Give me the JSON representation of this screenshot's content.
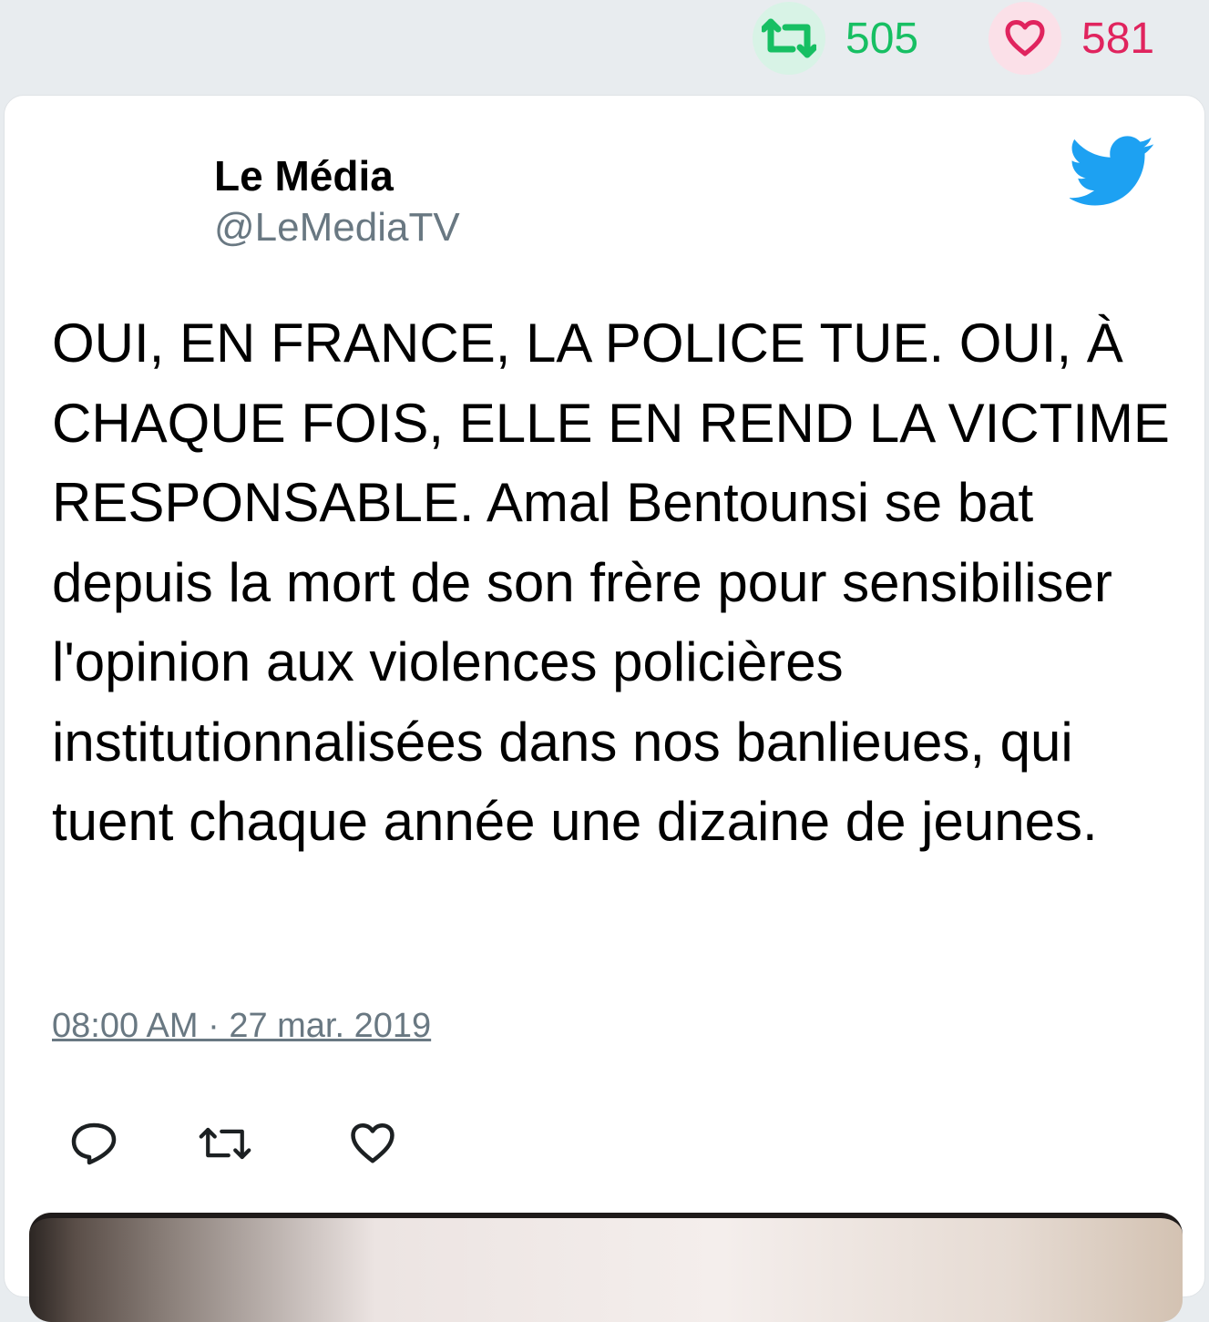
{
  "stats": {
    "retweets": "505",
    "likes": "581"
  },
  "author": {
    "name": "Le Média",
    "handle": "@LeMediaTV"
  },
  "tweet": {
    "text": "OUI, EN FRANCE, LA POLICE TUE. OUI, À CHAQUE FOIS, ELLE EN REND LA VICTIME RESPONSABLE. Amal Bentounsi se bat depuis la mort de son frère pour sensibiliser l'opinion aux violences policières institutionnalisées dans nos banlieues, qui tuent chaque année une dizaine de jeunes.",
    "timestamp": "08:00 AM · 27 mar. 2019"
  },
  "icons": {
    "retweet": "retweet-icon",
    "like": "heart-icon",
    "reply": "reply-icon",
    "brand": "twitter-bird-icon"
  },
  "colors": {
    "retweet": "#17bf63",
    "like": "#e0245e",
    "twitter_blue": "#1da1f2",
    "handle_gray": "#697882"
  }
}
